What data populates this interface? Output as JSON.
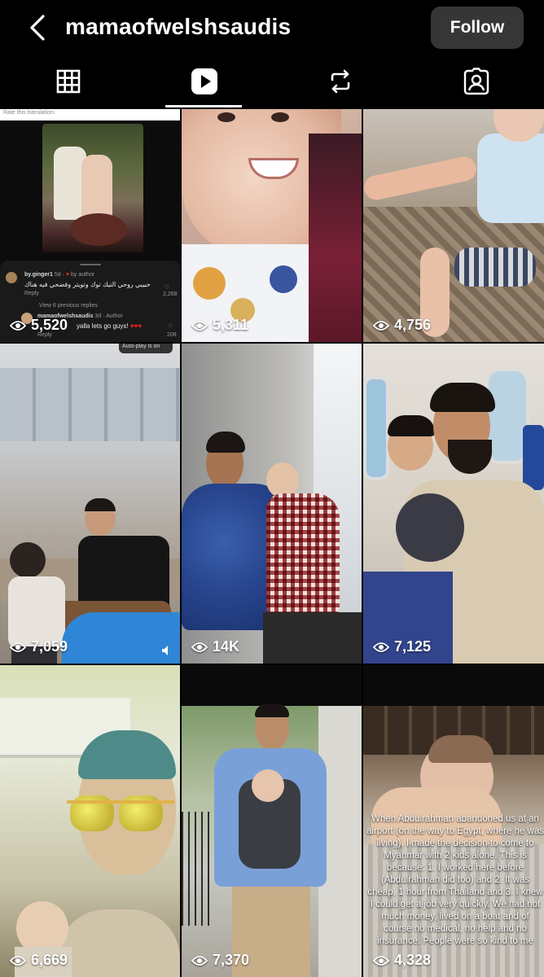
{
  "header": {
    "username": "mamaofwelshsaudis",
    "follow_label": "Follow"
  },
  "tabs": [
    {
      "name": "grid",
      "active": false
    },
    {
      "name": "reels",
      "active": true
    },
    {
      "name": "reposts",
      "active": false
    },
    {
      "name": "tagged",
      "active": false
    }
  ],
  "tiles": [
    {
      "views": "5,520"
    },
    {
      "views": "5,311"
    },
    {
      "views": "4,756"
    },
    {
      "views": "7,059"
    },
    {
      "views": "14K"
    },
    {
      "views": "7,125"
    },
    {
      "views": "6,669"
    },
    {
      "views": "7,370"
    },
    {
      "views": "4,328"
    }
  ],
  "tile1": {
    "translate": "Rate this translation:",
    "c1_user": "by.ginger1",
    "c1_time": "5d",
    "c1_by": "by author",
    "c1_text": "حبيبي روحي التيك توك وتويتر وفضحي فيه هناك",
    "reply": "Reply",
    "c1_count": "2,268",
    "view_replies": "View 6 previous replies",
    "c2_user": "mamaofwelshsaudis",
    "c2_time": "3d",
    "c2_author": "Author",
    "c2_text": "yalla lets go guys!",
    "c2_reply": "Reply",
    "c2_count": "208"
  },
  "tile4_label": "Auto-play is on",
  "tile9_overlay": "When Abdulrahman abandoned us at an airport (on the way to Egypt, where he was living), I made the decision to come to Myanmar with 2 kids alone. This is because: 1. I worked here before (Abdulrahman did too) and 2. It was cheap, 1 hour from Thailand and 3. I knew I could get a job very quickly. We had not much money, lived on a boat and of course no medical, no help and no insurance. People were so kind to me"
}
